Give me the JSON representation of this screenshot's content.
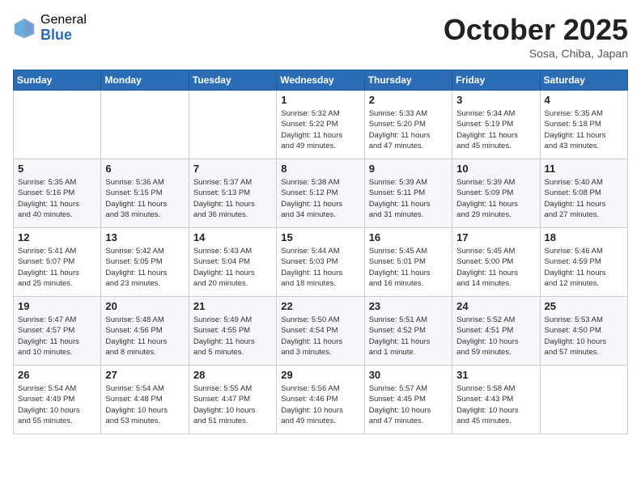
{
  "header": {
    "logo_general": "General",
    "logo_blue": "Blue",
    "month": "October 2025",
    "location": "Sosa, Chiba, Japan"
  },
  "weekdays": [
    "Sunday",
    "Monday",
    "Tuesday",
    "Wednesday",
    "Thursday",
    "Friday",
    "Saturday"
  ],
  "weeks": [
    [
      {
        "day": "",
        "text": ""
      },
      {
        "day": "",
        "text": ""
      },
      {
        "day": "",
        "text": ""
      },
      {
        "day": "1",
        "text": "Sunrise: 5:32 AM\nSunset: 5:22 PM\nDaylight: 11 hours\nand 49 minutes."
      },
      {
        "day": "2",
        "text": "Sunrise: 5:33 AM\nSunset: 5:20 PM\nDaylight: 11 hours\nand 47 minutes."
      },
      {
        "day": "3",
        "text": "Sunrise: 5:34 AM\nSunset: 5:19 PM\nDaylight: 11 hours\nand 45 minutes."
      },
      {
        "day": "4",
        "text": "Sunrise: 5:35 AM\nSunset: 5:18 PM\nDaylight: 11 hours\nand 43 minutes."
      }
    ],
    [
      {
        "day": "5",
        "text": "Sunrise: 5:35 AM\nSunset: 5:16 PM\nDaylight: 11 hours\nand 40 minutes."
      },
      {
        "day": "6",
        "text": "Sunrise: 5:36 AM\nSunset: 5:15 PM\nDaylight: 11 hours\nand 38 minutes."
      },
      {
        "day": "7",
        "text": "Sunrise: 5:37 AM\nSunset: 5:13 PM\nDaylight: 11 hours\nand 36 minutes."
      },
      {
        "day": "8",
        "text": "Sunrise: 5:38 AM\nSunset: 5:12 PM\nDaylight: 11 hours\nand 34 minutes."
      },
      {
        "day": "9",
        "text": "Sunrise: 5:39 AM\nSunset: 5:11 PM\nDaylight: 11 hours\nand 31 minutes."
      },
      {
        "day": "10",
        "text": "Sunrise: 5:39 AM\nSunset: 5:09 PM\nDaylight: 11 hours\nand 29 minutes."
      },
      {
        "day": "11",
        "text": "Sunrise: 5:40 AM\nSunset: 5:08 PM\nDaylight: 11 hours\nand 27 minutes."
      }
    ],
    [
      {
        "day": "12",
        "text": "Sunrise: 5:41 AM\nSunset: 5:07 PM\nDaylight: 11 hours\nand 25 minutes."
      },
      {
        "day": "13",
        "text": "Sunrise: 5:42 AM\nSunset: 5:05 PM\nDaylight: 11 hours\nand 23 minutes."
      },
      {
        "day": "14",
        "text": "Sunrise: 5:43 AM\nSunset: 5:04 PM\nDaylight: 11 hours\nand 20 minutes."
      },
      {
        "day": "15",
        "text": "Sunrise: 5:44 AM\nSunset: 5:03 PM\nDaylight: 11 hours\nand 18 minutes."
      },
      {
        "day": "16",
        "text": "Sunrise: 5:45 AM\nSunset: 5:01 PM\nDaylight: 11 hours\nand 16 minutes."
      },
      {
        "day": "17",
        "text": "Sunrise: 5:45 AM\nSunset: 5:00 PM\nDaylight: 11 hours\nand 14 minutes."
      },
      {
        "day": "18",
        "text": "Sunrise: 5:46 AM\nSunset: 4:59 PM\nDaylight: 11 hours\nand 12 minutes."
      }
    ],
    [
      {
        "day": "19",
        "text": "Sunrise: 5:47 AM\nSunset: 4:57 PM\nDaylight: 11 hours\nand 10 minutes."
      },
      {
        "day": "20",
        "text": "Sunrise: 5:48 AM\nSunset: 4:56 PM\nDaylight: 11 hours\nand 8 minutes."
      },
      {
        "day": "21",
        "text": "Sunrise: 5:49 AM\nSunset: 4:55 PM\nDaylight: 11 hours\nand 5 minutes."
      },
      {
        "day": "22",
        "text": "Sunrise: 5:50 AM\nSunset: 4:54 PM\nDaylight: 11 hours\nand 3 minutes."
      },
      {
        "day": "23",
        "text": "Sunrise: 5:51 AM\nSunset: 4:52 PM\nDaylight: 11 hours\nand 1 minute."
      },
      {
        "day": "24",
        "text": "Sunrise: 5:52 AM\nSunset: 4:51 PM\nDaylight: 10 hours\nand 59 minutes."
      },
      {
        "day": "25",
        "text": "Sunrise: 5:53 AM\nSunset: 4:50 PM\nDaylight: 10 hours\nand 57 minutes."
      }
    ],
    [
      {
        "day": "26",
        "text": "Sunrise: 5:54 AM\nSunset: 4:49 PM\nDaylight: 10 hours\nand 55 minutes."
      },
      {
        "day": "27",
        "text": "Sunrise: 5:54 AM\nSunset: 4:48 PM\nDaylight: 10 hours\nand 53 minutes."
      },
      {
        "day": "28",
        "text": "Sunrise: 5:55 AM\nSunset: 4:47 PM\nDaylight: 10 hours\nand 51 minutes."
      },
      {
        "day": "29",
        "text": "Sunrise: 5:56 AM\nSunset: 4:46 PM\nDaylight: 10 hours\nand 49 minutes."
      },
      {
        "day": "30",
        "text": "Sunrise: 5:57 AM\nSunset: 4:45 PM\nDaylight: 10 hours\nand 47 minutes."
      },
      {
        "day": "31",
        "text": "Sunrise: 5:58 AM\nSunset: 4:43 PM\nDaylight: 10 hours\nand 45 minutes."
      },
      {
        "day": "",
        "text": ""
      }
    ]
  ]
}
